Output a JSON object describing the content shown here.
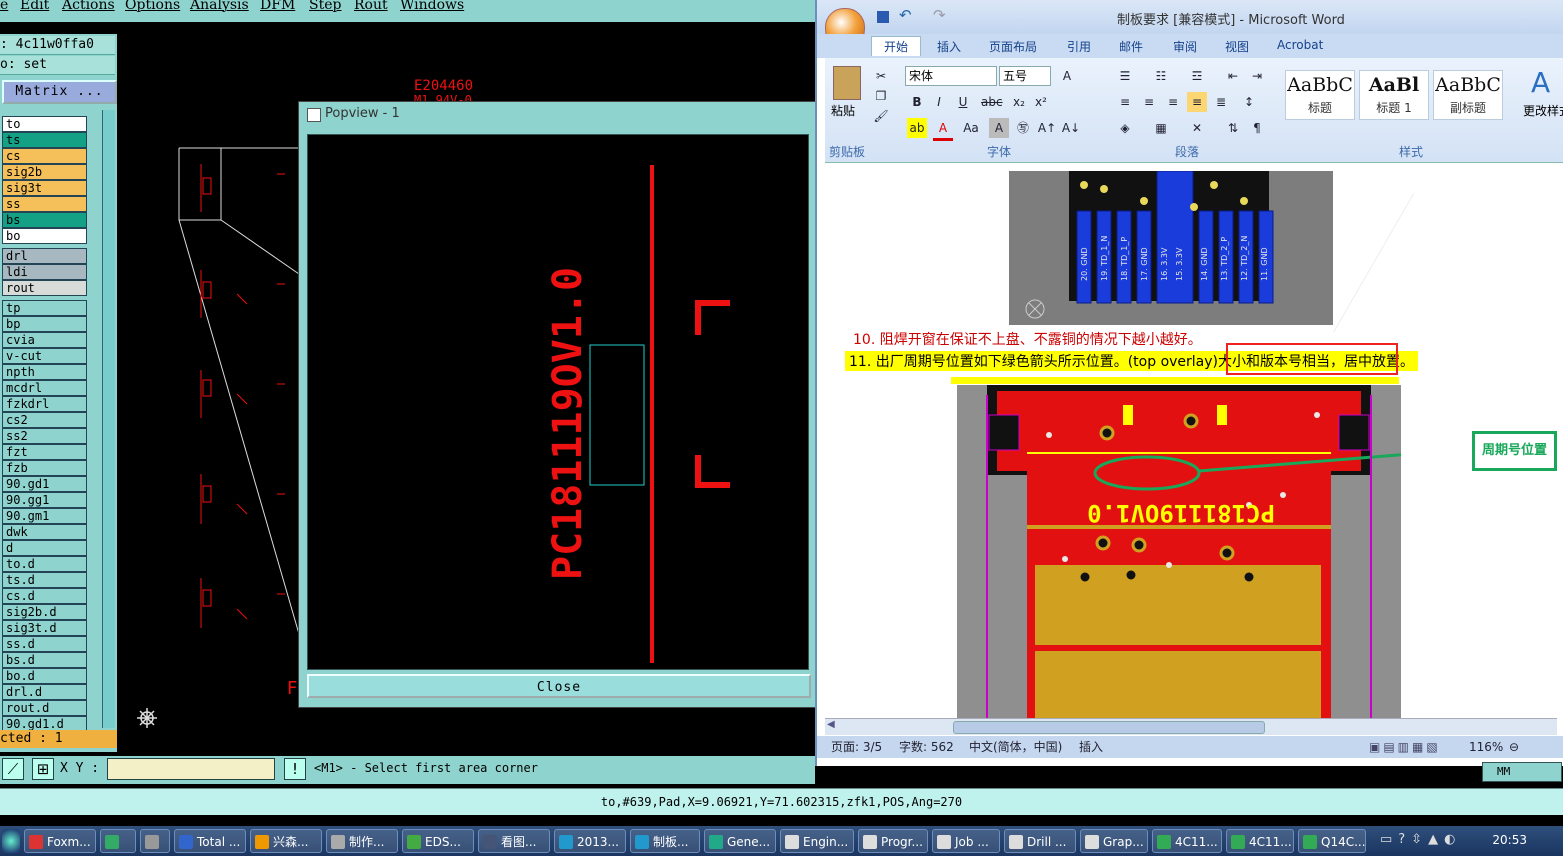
{
  "cam": {
    "menu": [
      "e",
      "Edit",
      "Actions",
      "Options",
      "Analysis",
      "DFM",
      "Step",
      "Rout",
      "Windows"
    ],
    "job_line": ": 4c11w0ffa0",
    "step_line": "o: set",
    "matrix_label": "Matrix ...",
    "layers": [
      {
        "name": "to",
        "color": "#ffffff"
      },
      {
        "name": "ts",
        "color": "#13a085"
      },
      {
        "name": "cs",
        "color": "#f5c05a"
      },
      {
        "name": "sig2b",
        "color": "#f5c05a"
      },
      {
        "name": "sig3t",
        "color": "#f5c05a"
      },
      {
        "name": "ss",
        "color": "#f5c05a"
      },
      {
        "name": "bs",
        "color": "#13a085"
      },
      {
        "name": "bo",
        "color": "#ffffff"
      },
      {
        "name": "drl",
        "color": "#a8b8c0"
      },
      {
        "name": "ldi",
        "color": "#a8b8c0"
      },
      {
        "name": "rout",
        "color": "#d8dcd8"
      },
      {
        "name": "tp",
        "color": "#8ed3cd"
      },
      {
        "name": "bp",
        "color": "#8ed3cd"
      },
      {
        "name": "cvia",
        "color": "#8ed3cd"
      },
      {
        "name": "v-cut",
        "color": "#8ed3cd"
      },
      {
        "name": "npth",
        "color": "#8ed3cd"
      },
      {
        "name": "mcdrl",
        "color": "#8ed3cd"
      },
      {
        "name": "fzkdrl",
        "color": "#8ed3cd"
      },
      {
        "name": "cs2",
        "color": "#8ed3cd"
      },
      {
        "name": "ss2",
        "color": "#8ed3cd"
      },
      {
        "name": "fzt",
        "color": "#8ed3cd"
      },
      {
        "name": "fzb",
        "color": "#8ed3cd"
      },
      {
        "name": "90.gd1",
        "color": "#8ed3cd"
      },
      {
        "name": "90.gg1",
        "color": "#8ed3cd"
      },
      {
        "name": "90.gm1",
        "color": "#8ed3cd"
      },
      {
        "name": "dwk",
        "color": "#8ed3cd"
      },
      {
        "name": "d",
        "color": "#8ed3cd"
      },
      {
        "name": "to.d",
        "color": "#8ed3cd"
      },
      {
        "name": "ts.d",
        "color": "#8ed3cd"
      },
      {
        "name": "cs.d",
        "color": "#8ed3cd"
      },
      {
        "name": "sig2b.d",
        "color": "#8ed3cd"
      },
      {
        "name": "sig3t.d",
        "color": "#8ed3cd"
      },
      {
        "name": "ss.d",
        "color": "#8ed3cd"
      },
      {
        "name": "bs.d",
        "color": "#8ed3cd"
      },
      {
        "name": "bo.d",
        "color": "#8ed3cd"
      },
      {
        "name": "drl.d",
        "color": "#8ed3cd"
      },
      {
        "name": "rout.d",
        "color": "#8ed3cd"
      },
      {
        "name": "90.gd1.d",
        "color": "#8ed3cd"
      }
    ],
    "selected_text": "cted : 1",
    "xy_label": "X Y :",
    "prompt": "<M1> - Select first area corner",
    "status_line": "to,#639,Pad,X=9.06921,Y=71.602315,zfk1,POS,Ang=270",
    "canvas_text_top": "E204460",
    "canvas_text_2": "M1 94V-0",
    "popview_title": "Popview - 1",
    "popview_label": "PC181119OV1.0",
    "close_label": "Close",
    "mm_label": "MM"
  },
  "word": {
    "title": "制板要求 [兼容模式] - Microsoft Word",
    "tabs": [
      "开始",
      "插入",
      "页面布局",
      "引用",
      "邮件",
      "审阅",
      "视图",
      "Acrobat"
    ],
    "font_name": "宋体",
    "font_size": "五号",
    "groups": [
      "剪贴板",
      "字体",
      "段落",
      "样式"
    ],
    "paste_label": "粘贴",
    "styles": [
      {
        "preview": "AaBbC",
        "name": "标题"
      },
      {
        "preview": "AaBl",
        "name": "标题 1"
      },
      {
        "preview": "AaBbC",
        "name": "副标题"
      }
    ],
    "change_styles": "更改样式",
    "pin_labels": [
      "20. GND",
      "19. TD_1_N",
      "18. TD_1_P",
      "17. GND",
      "16. 3.3V",
      "15. 3.3V",
      "14. GND",
      "13. TD_2_P",
      "12. TD_2_N",
      "11. GND"
    ],
    "item10": "10. 阻焊开窗在保证不上盘、不露铜的情况下越小越好。",
    "item11_prefix": "11. 出厂周期号位置如下绿色箭头所示位置。(top overlay)大小和版本号相当，居中放置。",
    "callout": "周期号位置",
    "pcb_text": "PC181119OV1.0",
    "status": {
      "page": "页面: 3/5",
      "words": "字数: 562",
      "lang": "中文(简体，中国)",
      "mode": "插入",
      "zoom": "116%"
    }
  },
  "taskbar": {
    "items": [
      {
        "label": "Foxm...",
        "color": "#d33"
      },
      {
        "label": "",
        "color": "#3a6"
      },
      {
        "label": "",
        "color": "#999"
      },
      {
        "label": "Total ...",
        "color": "#36c"
      },
      {
        "label": "兴森...",
        "color": "#e90"
      },
      {
        "label": "制作...",
        "color": "#aaa"
      },
      {
        "label": "EDS...",
        "color": "#4a4"
      },
      {
        "label": "看图...",
        "color": "#457"
      },
      {
        "label": "2013...",
        "color": "#29c"
      },
      {
        "label": "制板...",
        "color": "#29c"
      },
      {
        "label": "Gene...",
        "color": "#2a8"
      },
      {
        "label": "Engin...",
        "color": "#ddd"
      },
      {
        "label": "Progr...",
        "color": "#ddd"
      },
      {
        "label": "Job ...",
        "color": "#ddd"
      },
      {
        "label": "Drill ...",
        "color": "#ddd"
      },
      {
        "label": "Grap...",
        "color": "#ddd"
      },
      {
        "label": "4C11...",
        "color": "#3a5"
      },
      {
        "label": "4C11...",
        "color": "#3a5"
      },
      {
        "label": "Q14C...",
        "color": "#3a5"
      }
    ],
    "time": "20:53"
  }
}
